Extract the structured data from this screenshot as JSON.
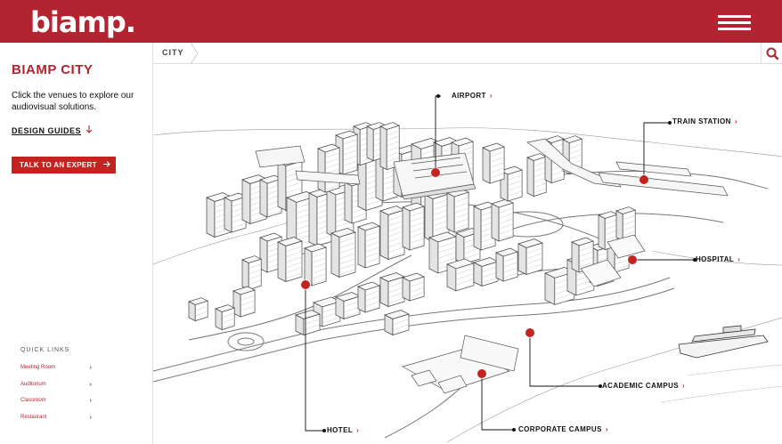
{
  "header": {
    "logo_text": "biamp.",
    "menu_icon": "hamburger-menu-icon",
    "brand_color": "#b22530"
  },
  "sidebar": {
    "title": "BIAMP CITY",
    "intro": "Click the venues to explore our audiovisual solutions.",
    "design_guides_label": "DESIGN GUIDES",
    "design_guides_icon": "arrow-down-icon",
    "expert_button_label": "TALK TO AN EXPERT",
    "expert_button_icon": "arrow-right-icon",
    "quick_links_title": "QUICK LINKS",
    "quick_links": [
      {
        "label": "Meeting Room"
      },
      {
        "label": "Auditorium"
      },
      {
        "label": "Classroom"
      },
      {
        "label": "Restaurant"
      }
    ]
  },
  "breadcrumb": {
    "current": "CITY",
    "search_icon": "search-icon"
  },
  "map": {
    "pin_color": "#c4241f",
    "venues": [
      {
        "id": "airport",
        "label": "AIRPORT"
      },
      {
        "id": "train-station",
        "label": "TRAIN STATION"
      },
      {
        "id": "hospital",
        "label": "HOSPITAL"
      },
      {
        "id": "academic-campus",
        "label": "ACADEMIC CAMPUS"
      },
      {
        "id": "corporate-campus",
        "label": "CORPORATE CAMPUS"
      },
      {
        "id": "hotel",
        "label": "HOTEL"
      }
    ]
  }
}
